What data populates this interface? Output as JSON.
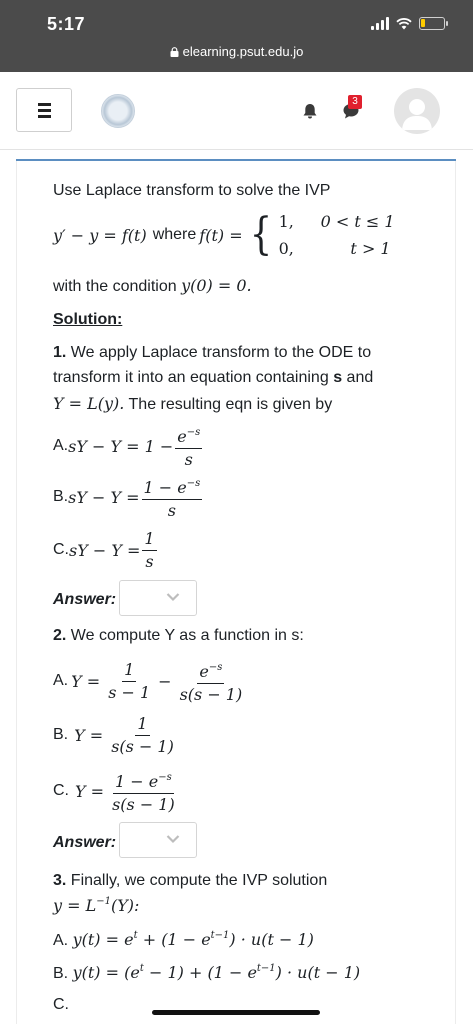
{
  "status_bar": {
    "time": "5:17"
  },
  "browser": {
    "url": "elearning.psut.edu.jo"
  },
  "nav": {
    "notifications_badge": "3"
  },
  "question": {
    "intro": "Use Laplace transform to solve the IVP",
    "ode_lhs": "y′ − y = f(t)",
    "where_text": "where",
    "f_def": "f(t) =",
    "case1_value": "1,",
    "case1_cond": "0 < t ≤ 1",
    "case2_value": "0,",
    "case2_cond": "t > 1",
    "condition_text": "with the condition",
    "condition_math": "y(0) = 0."
  },
  "solution": {
    "heading": "Solution:",
    "step1": {
      "number": "1.",
      "line1": "We apply Laplace transform to the ODE to",
      "line2_a": "transform it into an equation containing",
      "line2_s": "s",
      "line2_b": "and",
      "line3_math": "Y = L(y).",
      "line3_text": "The resulting eqn is given by",
      "option_a_label": "A.",
      "option_a_lhs": "sY − Y = 1 −",
      "option_a_num": "e",
      "option_a_num_sup": "−s",
      "option_a_den": "s",
      "option_b_label": "B.",
      "option_b_lhs": "sY − Y =",
      "option_b_num": "1 − e",
      "option_b_num_sup": "−s",
      "option_b_den": "s",
      "option_c_label": "C.",
      "option_c_lhs": "sY − Y =",
      "option_c_num": "1",
      "option_c_den": "s",
      "answer_label": "Answer:"
    },
    "step2": {
      "number": "2.",
      "text": "We compute Y as a function in s:",
      "option_a_label": "A.",
      "option_a_lhs": "Y =",
      "option_a_frac1_num": "1",
      "option_a_frac1_den": "s − 1",
      "option_a_minus": "−",
      "option_a_frac2_num": "e",
      "option_a_frac2_num_sup": "−s",
      "option_a_frac2_den": "s(s − 1)",
      "option_b_label": "B.",
      "option_b_lhs": "Y =",
      "option_b_num": "1",
      "option_b_den": "s(s − 1)",
      "option_c_label": "C.",
      "option_c_lhs": "Y =",
      "option_c_num": "1 − e",
      "option_c_num_sup": "−s",
      "option_c_den": "s(s − 1)",
      "answer_label": "Answer:"
    },
    "step3": {
      "number": "3.",
      "text": "Finally, we compute the IVP solution",
      "line2_math": "y = L",
      "line2_sup": "−1",
      "line2_tail": "(Y):",
      "option_a_label": "A.",
      "option_a_math_1": "y(t) = e",
      "option_a_sup_1": "t",
      "option_a_math_2": " + (1 − e",
      "option_a_sup_2": "t−1",
      "option_a_math_3": ") · u(t − 1)",
      "option_b_label": "B.",
      "option_b_math_1": "y(t) = (e",
      "option_b_sup_1": "t",
      "option_b_math_2": " − 1) + (1 − e",
      "option_b_sup_2": "t−1",
      "option_b_math_3": ") · u(t − 1)",
      "option_c_label": "C."
    }
  },
  "colors": {
    "accent_rule": "#5b8ec1",
    "badge": "#e0202e",
    "top_chrome": "#4b4b4b"
  }
}
